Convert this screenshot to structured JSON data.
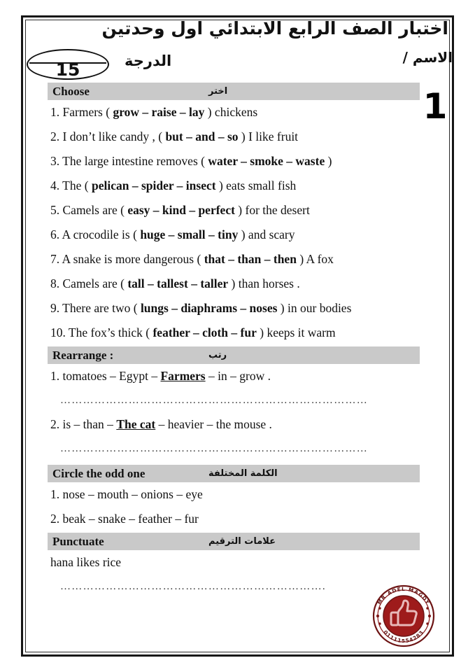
{
  "header": {
    "exam_title": "اختبار الصف الرابع الابتدائي اول وحدتين",
    "name_label": "الاسم /",
    "grade_label": "الدرجة",
    "grade_value": "15",
    "sheet_number": "1"
  },
  "sections": [
    {
      "en": "Choose",
      "ar": "اختر",
      "items": [
        "1. Farmers (  grow &ndash; raise &ndash; lay ) chickens",
        "2. I don’t like candy , ( but &ndash; and &ndash; so ) I like fruit",
        "3. The large intestine removes ( water &ndash; smoke &ndash; waste )",
        "4. The ( pelican &ndash; spider &ndash; insect ) eats small fish",
        "5. Camels are ( easy &ndash; kind &ndash; perfect ) for the desert",
        "6. A crocodile is ( huge &ndash; small &ndash; tiny ) and scary",
        "7. A snake is more dangerous ( that &ndash; than &ndash; then ) A fox",
        "8. Camels are ( tall &ndash; tallest &ndash; taller ) than horses .",
        "9. There are two ( lungs &ndash; diaphrams &ndash; noses ) in our bodies",
        "10. The fox’s thick ( feather &ndash; cloth &ndash; fur ) keeps it warm"
      ]
    },
    {
      "en": "Rearrange :",
      "ar": "رتب",
      "items": [
        "1. tomatoes &ndash; Egypt &ndash; Farmers &ndash; in &ndash; grow .",
        "2. is &ndash; than &ndash; The cat &ndash; heavier &ndash; the mouse ."
      ]
    },
    {
      "en": "Circle the odd one",
      "ar": "الكلمة المختلفة",
      "items": [
        "1. nose &ndash; mouth &ndash; onions &ndash; eye",
        "2. beak &ndash; snake &ndash; feather &ndash; fur"
      ]
    },
    {
      "en": "Punctuate",
      "ar": "علامات الترقيم",
      "items": [
        "hana likes rice"
      ]
    }
  ],
  "choose": {
    "q1": {
      "pre": "1. Farmers ( ",
      "bold": "grow – raise – lay",
      "post": " ) chickens"
    },
    "q2": {
      "pre": "2. I don’t like candy , ( ",
      "bold": "but – and – so",
      "post": " ) I like fruit"
    },
    "q3": {
      "pre": "3. The large intestine removes ( ",
      "bold": "water – smoke – waste",
      "post": " )"
    },
    "q4": {
      "pre": "4. The ( ",
      "bold": "pelican – spider – insect",
      "post": " ) eats small fish"
    },
    "q5": {
      "pre": "5. Camels are ( ",
      "bold": "easy – kind – perfect",
      "post": " ) for the desert"
    },
    "q6": {
      "pre": "6. A crocodile is ( ",
      "bold": "huge – small – tiny",
      "post": " ) and scary"
    },
    "q7": {
      "pre": "7. A snake is more dangerous ( ",
      "bold": "that – than – then",
      "post": " ) A fox"
    },
    "q8": {
      "pre": "8. Camels are ( ",
      "bold": "tall – tallest – taller",
      "post": " ) than horses ."
    },
    "q9": {
      "pre": "9. There are two ( ",
      "bold": "lungs – diaphrams – noses",
      "post": " ) in our bodies"
    },
    "q10": {
      "pre": "10. The fox’s thick ( ",
      "bold": "feather – cloth – fur",
      "post": " ) keeps it warm"
    }
  },
  "rearrange": {
    "r1": {
      "pre": "1. tomatoes – Egypt – ",
      "emph": "Farmers",
      "post": " – in – grow ."
    },
    "r2": {
      "pre": "2. is – than – ",
      "emph": "The cat",
      "post": " – heavier – the mouse ."
    }
  },
  "odd_one": {
    "o1": "1. nose – mouth – onions – eye",
    "o2": "2. beak – snake – feather – fur"
  },
  "punctuate": {
    "p1": "hana likes rice"
  },
  "answer_lines": {
    "line_plain": "………………………………………………………………………",
    "line_short": "……………………………………………….",
    "line_dot_end": "……………………………………………………………."
  },
  "stamp": {
    "top_text": "MR ADEL MAGDY",
    "bottom_text": "01111554283",
    "icon": "thumbs-up-icon",
    "color": "#9e1b1b"
  },
  "colors": {
    "section_bar": "#c9c9c9",
    "frame": "#151515",
    "stamp_red": "#9e1b1b",
    "stamp_dark": "#5e1010"
  }
}
